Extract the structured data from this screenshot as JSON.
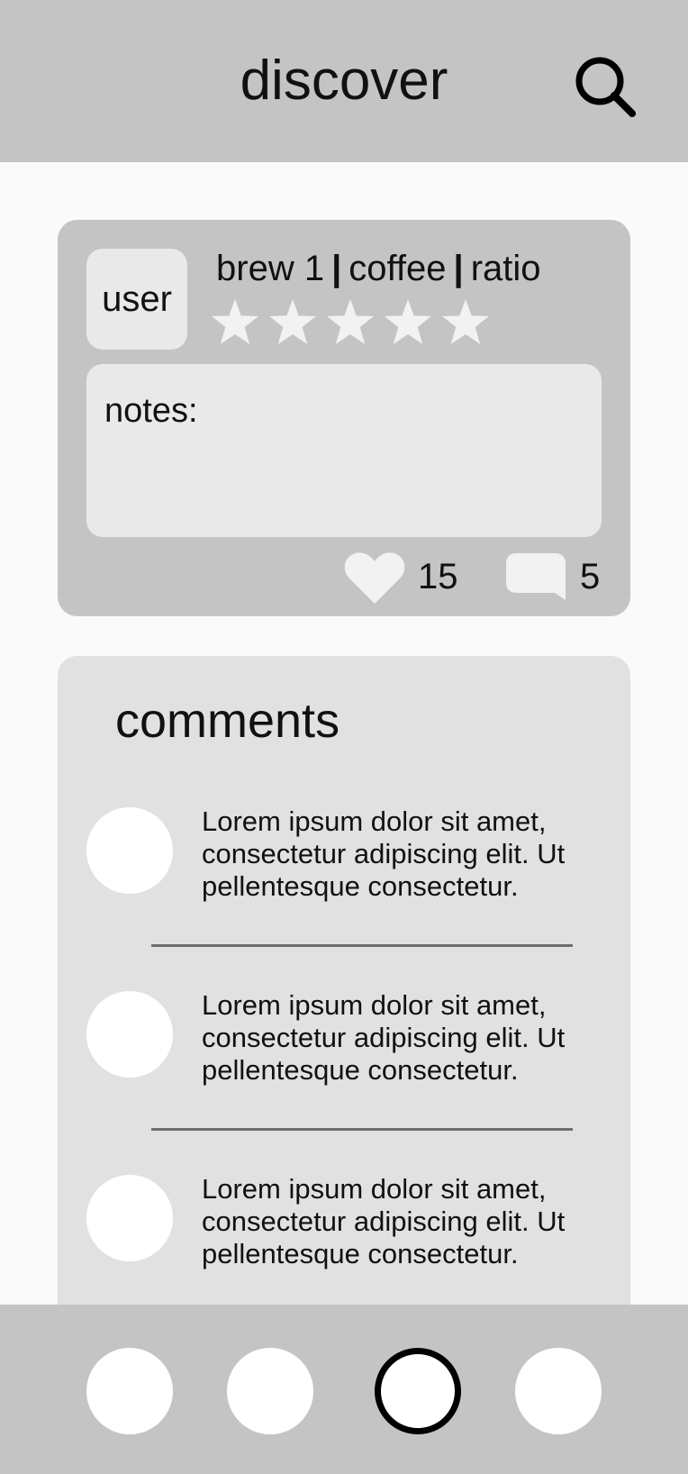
{
  "header": {
    "title": "discover",
    "search_icon": "search-icon"
  },
  "post": {
    "user_label": "user",
    "brew_name": "brew 1",
    "separator": "|",
    "coffee_label": "coffee",
    "ratio_label": "ratio",
    "rating": {
      "value": 0,
      "max": 5,
      "star_icon": "star-icon"
    },
    "notes_label": "notes:",
    "likes": {
      "icon": "heart-icon",
      "count": "15"
    },
    "comments": {
      "icon": "comment-icon",
      "count": "5"
    }
  },
  "comments_panel": {
    "title": "comments",
    "items": [
      {
        "text": "Lorem ipsum dolor sit amet, consectetur adipiscing elit. Ut pellentesque consectetur."
      },
      {
        "text": "Lorem ipsum dolor sit amet, consectetur adipiscing elit. Ut pellentesque consectetur."
      },
      {
        "text": "Lorem ipsum dolor sit amet, consectetur adipiscing elit. Ut pellentesque consectetur."
      }
    ]
  },
  "bottom_nav": {
    "items": [
      {
        "name": "nav-item-1",
        "active": false
      },
      {
        "name": "nav-item-2",
        "active": false
      },
      {
        "name": "nav-item-3",
        "active": true
      },
      {
        "name": "nav-item-4",
        "active": false
      }
    ]
  },
  "colors": {
    "header_bg": "#c4c4c4",
    "page_bg": "#fafafa",
    "card_bg": "#c4c4c4",
    "inner_box_bg": "#e9e9e9",
    "comments_bg": "#e1e1e1",
    "divider": "#6e6e6e",
    "star": "#f2f2f2",
    "active_outline": "#000000"
  }
}
